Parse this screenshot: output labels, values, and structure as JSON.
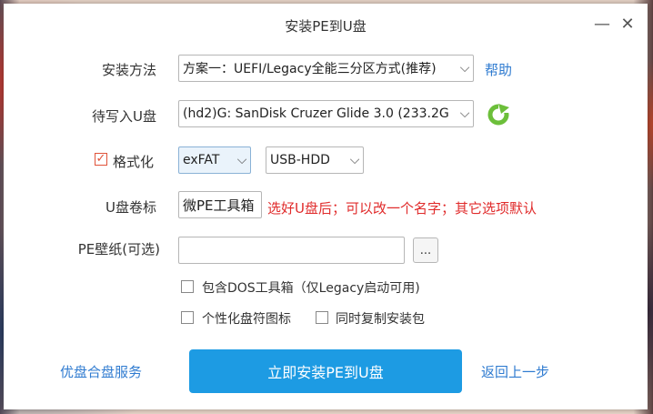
{
  "window": {
    "title": "安装PE到U盘",
    "minimize": "—",
    "close": "✕"
  },
  "install_method": {
    "label": "安装方法",
    "value": "方案一：UEFI/Legacy全能三分区方式(推荐)",
    "help": "帮助"
  },
  "target_disk": {
    "label": "待写入U盘",
    "value": "(hd2)G: SanDisk Cruzer Glide 3.0 (233.2G"
  },
  "format": {
    "label": "格式化",
    "checked": true,
    "fs_value": "exFAT",
    "mode_value": "USB-HDD"
  },
  "volume": {
    "label": "U盘卷标",
    "value": "微PE工具箱",
    "annotation": "选好U盘后；可以改一个名字；其它选项默认"
  },
  "wallpaper": {
    "label": "PE壁纸(可选)",
    "value": "",
    "browse": "..."
  },
  "options": {
    "dos_tools": "包含DOS工具箱（仅Legacy启动可用)",
    "custom_icon": "个性化盘符图标",
    "copy_installer": "同时复制安装包"
  },
  "footer": {
    "service_link": "优盘合盘服务",
    "install_button": "立即安装PE到U盘",
    "back_link": "返回上一步"
  },
  "colors": {
    "accent": "#1d9be3",
    "link": "#2f7bd0",
    "annotation": "#e02b2b",
    "refresh": "#6cbf3a"
  }
}
